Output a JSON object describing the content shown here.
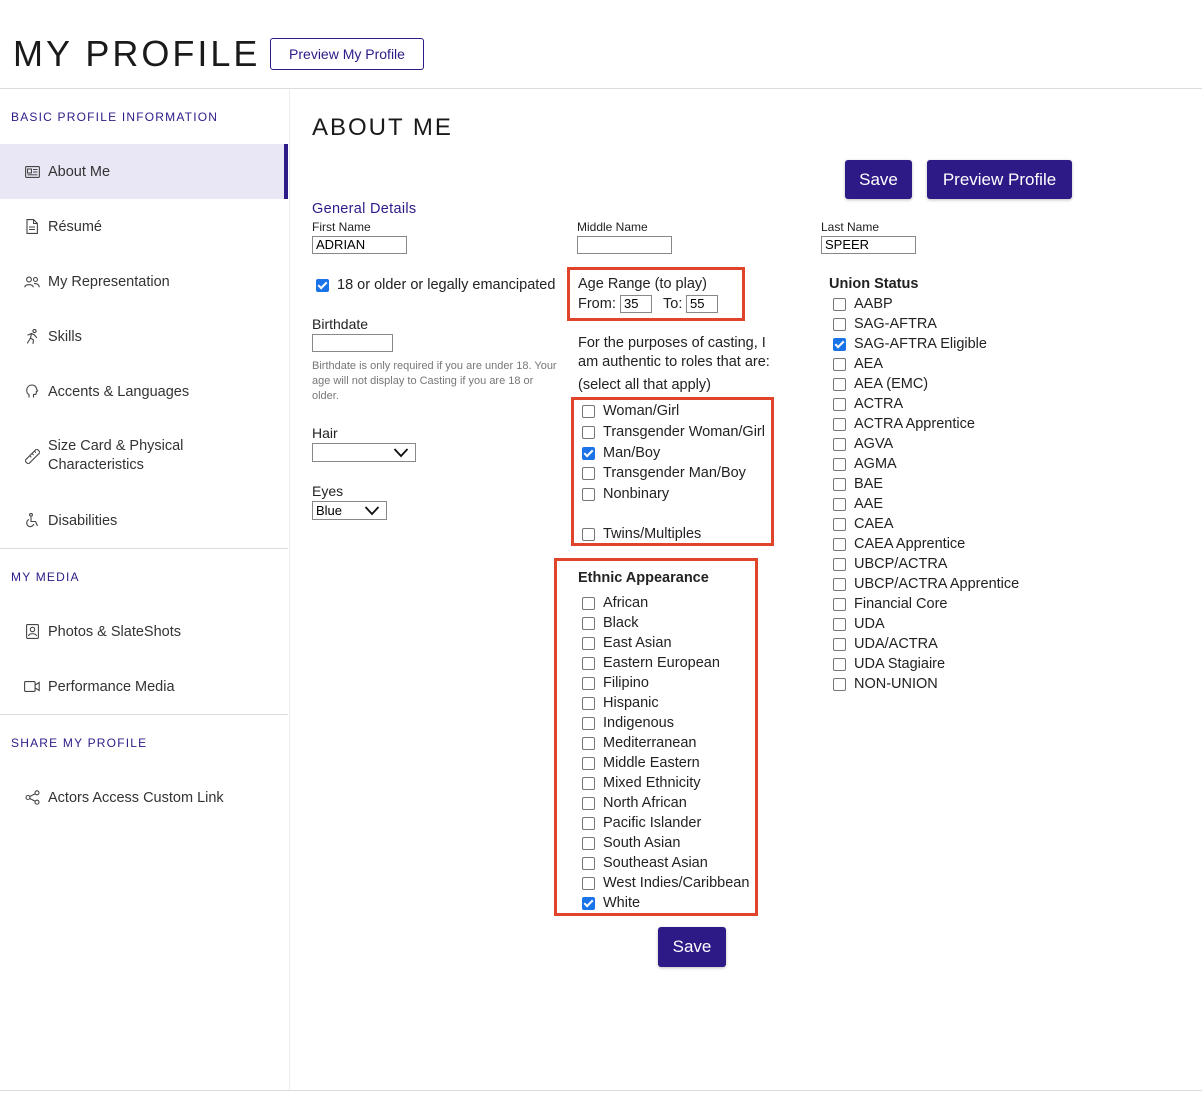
{
  "header": {
    "title": "MY PROFILE",
    "preview_button": "Preview My Profile"
  },
  "sidebar": {
    "section_basic": "BASIC PROFILE INFORMATION",
    "section_media": "MY MEDIA",
    "section_share": "SHARE MY PROFILE",
    "items": [
      {
        "label": "About Me",
        "icon": "id-card-icon",
        "active": true
      },
      {
        "label": "Résumé",
        "icon": "document-icon"
      },
      {
        "label": "My Representation",
        "icon": "people-icon"
      },
      {
        "label": "Skills",
        "icon": "running-person-icon"
      },
      {
        "label": "Accents & Languages",
        "icon": "speaking-head-icon"
      },
      {
        "label": "Size Card & Physical Characteristics",
        "icon": "ruler-icon"
      },
      {
        "label": "Disabilities",
        "icon": "wheelchair-icon"
      },
      {
        "label": "Photos & SlateShots",
        "icon": "portrait-icon"
      },
      {
        "label": "Performance Media",
        "icon": "video-camera-icon"
      },
      {
        "label": "Actors Access Custom Link",
        "icon": "share-icon"
      }
    ]
  },
  "main": {
    "title": "ABOUT ME",
    "save_label": "Save",
    "preview_label": "Preview Profile",
    "general_details": "General Details",
    "first_name_label": "First Name",
    "first_name_value": "ADRIAN",
    "middle_name_label": "Middle Name",
    "middle_name_value": "",
    "last_name_label": "Last Name",
    "last_name_value": "SPEER",
    "adult_checkbox_label": "18 or older or legally emancipated",
    "adult_checked": true,
    "birthdate_label": "Birthdate",
    "birthdate_value": "",
    "birthdate_help": "Birthdate is only required if you are under 18. Your age will not display to Casting if you are 18 or older.",
    "hair_label": "Hair",
    "hair_value": "",
    "eyes_label": "Eyes",
    "eyes_value": "Blue",
    "age_range_label": "Age Range (to play)",
    "age_from_label": "From:",
    "age_from_value": "35",
    "age_to_label": "To:",
    "age_to_value": "55",
    "authentic_text": "For the purposes of casting, I am authentic to roles that are:",
    "select_all_text": "(select all that apply)",
    "gender_options": [
      {
        "label": "Woman/Girl",
        "checked": false
      },
      {
        "label": "Transgender Woman/Girl",
        "checked": false
      },
      {
        "label": "Man/Boy",
        "checked": true
      },
      {
        "label": "Transgender Man/Boy",
        "checked": false
      },
      {
        "label": "Nonbinary",
        "checked": false
      },
      {
        "label": "Twins/Multiples",
        "checked": false
      }
    ],
    "ethnic_heading": "Ethnic Appearance",
    "ethnic_options": [
      {
        "label": "African",
        "checked": false
      },
      {
        "label": "Black",
        "checked": false
      },
      {
        "label": "East Asian",
        "checked": false
      },
      {
        "label": "Eastern European",
        "checked": false
      },
      {
        "label": "Filipino",
        "checked": false
      },
      {
        "label": "Hispanic",
        "checked": false
      },
      {
        "label": "Indigenous",
        "checked": false
      },
      {
        "label": "Mediterranean",
        "checked": false
      },
      {
        "label": "Middle Eastern",
        "checked": false
      },
      {
        "label": "Mixed Ethnicity",
        "checked": false
      },
      {
        "label": "North African",
        "checked": false
      },
      {
        "label": "Pacific Islander",
        "checked": false
      },
      {
        "label": "South Asian",
        "checked": false
      },
      {
        "label": "Southeast Asian",
        "checked": false
      },
      {
        "label": "West Indies/Caribbean",
        "checked": false
      },
      {
        "label": "White",
        "checked": true
      }
    ],
    "union_heading": "Union Status",
    "union_options": [
      {
        "label": "AABP",
        "checked": false
      },
      {
        "label": "SAG-AFTRA",
        "checked": false
      },
      {
        "label": "SAG-AFTRA Eligible",
        "checked": true
      },
      {
        "label": "AEA",
        "checked": false
      },
      {
        "label": "AEA (EMC)",
        "checked": false
      },
      {
        "label": "ACTRA",
        "checked": false
      },
      {
        "label": "ACTRA Apprentice",
        "checked": false
      },
      {
        "label": "AGVA",
        "checked": false
      },
      {
        "label": "AGMA",
        "checked": false
      },
      {
        "label": "BAE",
        "checked": false
      },
      {
        "label": "AAE",
        "checked": false
      },
      {
        "label": "CAEA",
        "checked": false
      },
      {
        "label": "CAEA Apprentice",
        "checked": false
      },
      {
        "label": "UBCP/ACTRA",
        "checked": false
      },
      {
        "label": "UBCP/ACTRA Apprentice",
        "checked": false
      },
      {
        "label": "Financial Core",
        "checked": false
      },
      {
        "label": "UDA",
        "checked": false
      },
      {
        "label": "UDA/ACTRA",
        "checked": false
      },
      {
        "label": "UDA Stagiaire",
        "checked": false
      },
      {
        "label": "NON-UNION",
        "checked": false
      }
    ]
  },
  "colors": {
    "brand": "#2e1a87",
    "highlight_box": "#e0452c",
    "active_bg": "#e9e6f5",
    "checkbox_checked": "#1a73e8"
  }
}
